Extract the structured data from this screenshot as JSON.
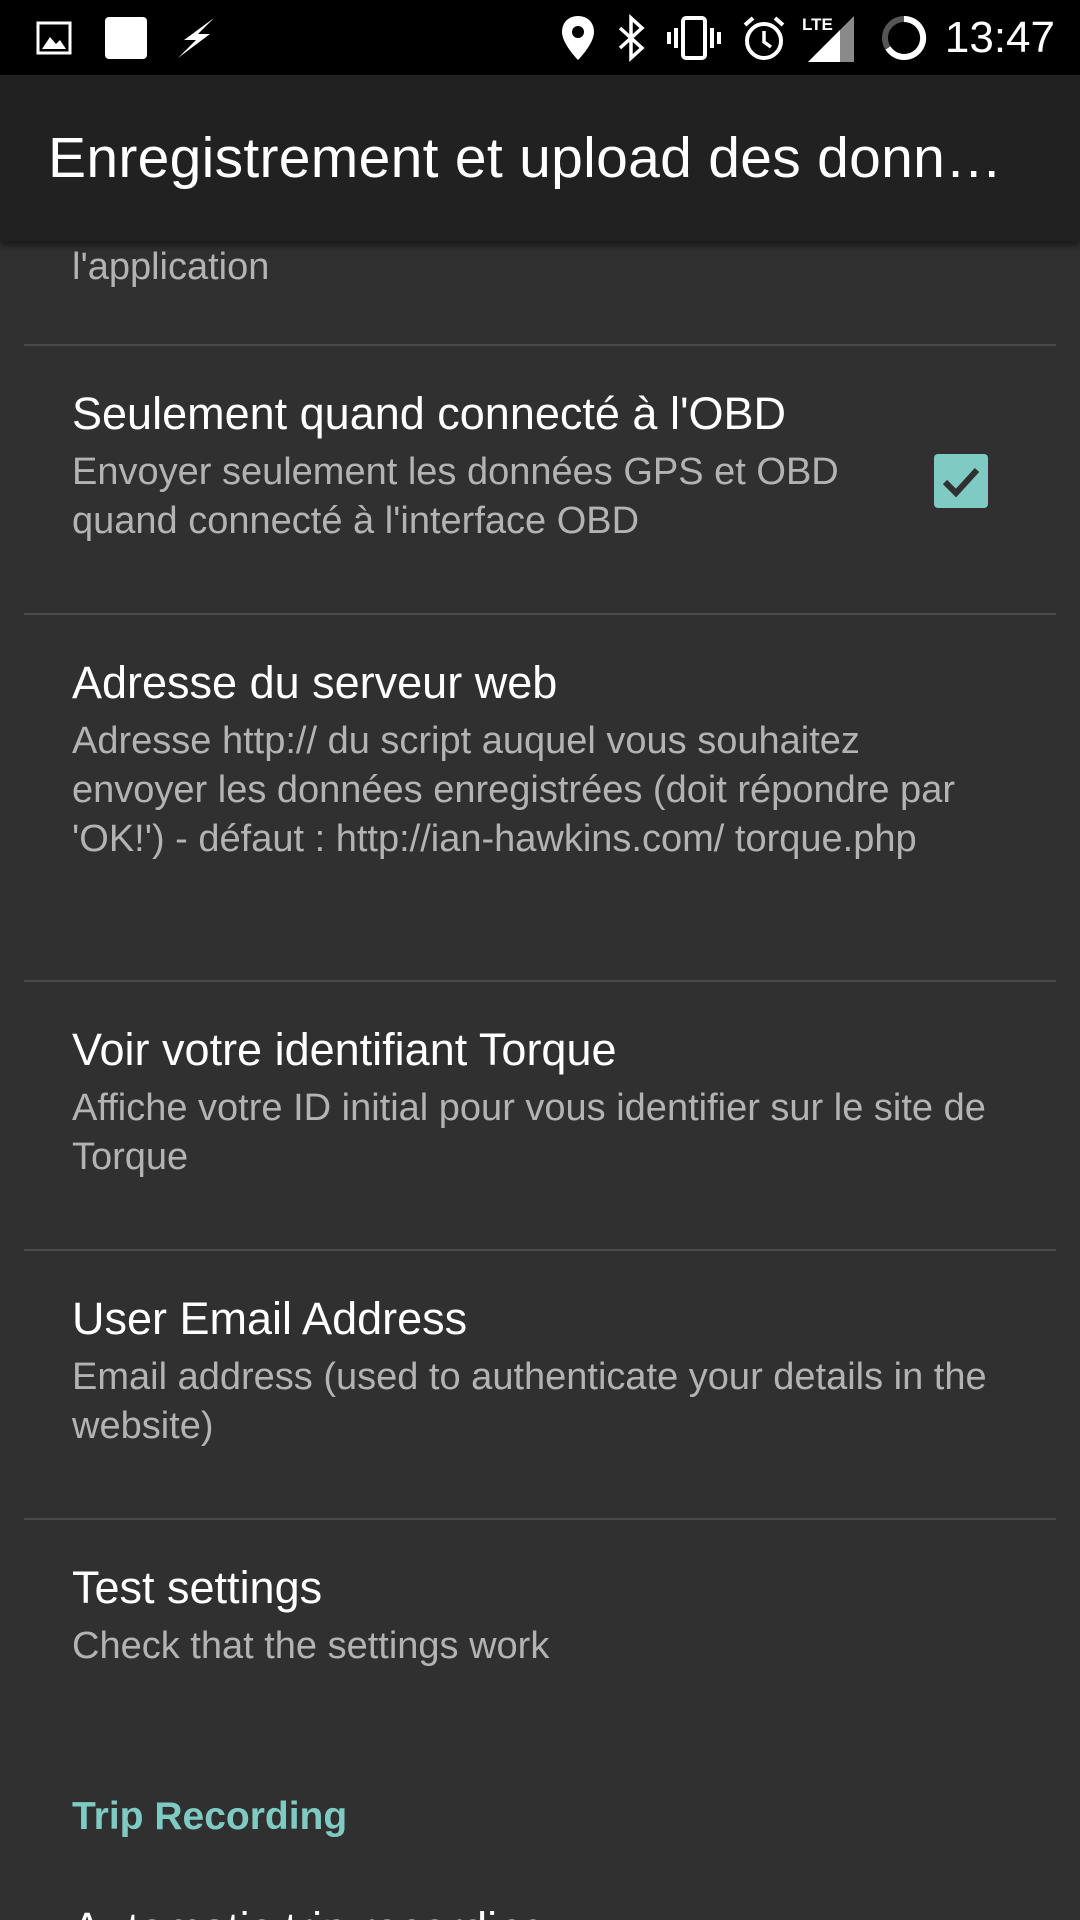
{
  "status_bar": {
    "time": "13:47",
    "network_type": "LTE",
    "icons": [
      "image-icon",
      "square-notification-icon",
      "flash-icon",
      "location-icon",
      "bluetooth-icon",
      "vibrate-icon",
      "alarm-icon",
      "lte-signal-icon",
      "loading-ring-icon"
    ]
  },
  "app_bar": {
    "title": "Enregistrement et upload des données"
  },
  "preferences": {
    "partial_summary": "l'application",
    "obd_only": {
      "title": "Seulement quand connecté à l'OBD",
      "summary": "Envoyer seulement les données GPS et OBD quand connecté à l'interface OBD",
      "checked": true
    },
    "server_address": {
      "title": "Adresse du serveur web",
      "summary": "Adresse http:// du script auquel vous souhaitez envoyer les données enregistrées (doit répondre par 'OK!') - défaut : http://ian-hawkins.com/ torque.php"
    },
    "torque_id": {
      "title": "Voir votre identifiant Torque",
      "summary": "Affiche votre ID initial pour vous identifier sur le site de Torque"
    },
    "user_email": {
      "title": "User Email Address",
      "summary": "Email address (used to authenticate your details in the website)"
    },
    "test_settings": {
      "title": "Test settings",
      "summary": "Check that the settings work"
    },
    "trip_category": "Trip Recording",
    "next_item_title": "Automatic trip recording"
  },
  "colors": {
    "accent": "#7fcbc4",
    "background": "#303030",
    "app_bar": "#212121",
    "status_bar": "#000000",
    "divider": "#4a4a4a",
    "summary_text": "#b3b3b3"
  }
}
